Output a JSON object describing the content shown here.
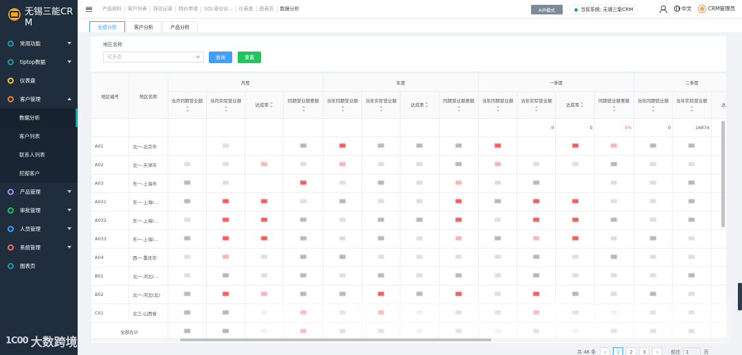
{
  "app": {
    "title": "无锡三能CRM"
  },
  "sidebar": {
    "items": [
      {
        "label": "常用功能",
        "color": "#1e9aa8",
        "caret": "down"
      },
      {
        "label": "tiptop数据",
        "color": "#1e9aa8",
        "caret": "down"
      },
      {
        "label": "仪表盘",
        "color": "#f5d020",
        "caret": ""
      },
      {
        "label": "客户管理",
        "color": "#f5863a",
        "caret": "up"
      }
    ],
    "sub_items": [
      {
        "label": "数据分析",
        "active": true
      },
      {
        "label": "客户列表",
        "active": false
      },
      {
        "label": "联系人列表",
        "active": false
      },
      {
        "label": "挖掘客户",
        "active": false
      }
    ],
    "items_after": [
      {
        "label": "产品管理",
        "color": "#a98ef5",
        "caret": "down"
      },
      {
        "label": "审批管理",
        "color": "#1fc55d",
        "caret": "down"
      },
      {
        "label": "人员管理",
        "color": "#409eff",
        "caret": "down"
      },
      {
        "label": "系统管理",
        "color": "#f56c6c",
        "caret": "down"
      },
      {
        "label": "图表页",
        "color": "#1e9aa8",
        "caret": ""
      }
    ],
    "watermark": "大数跨境",
    "watermark_logo": "1C00"
  },
  "topbar": {
    "nav": [
      "产品资料",
      "客户列表",
      "拜访记录",
      "特价申请",
      "SQL语句设...",
      "仪表盘",
      "图表页",
      "数据分析"
    ],
    "air_mode": "AIR模式",
    "current_system": "当前系统: 无锡三能CRM",
    "language": "中文",
    "user": "CRM管理员"
  },
  "tabs": [
    "业绩分析",
    "客户分析",
    "产品分析"
  ],
  "filter": {
    "label": "地区名称",
    "placeholder": "可多选",
    "query": "查询",
    "reset": "重置"
  },
  "table": {
    "col_code": "地区编号",
    "col_name": "地区名称",
    "groups": [
      "月度",
      "年度",
      "一季度",
      "二季度"
    ],
    "sub_cols": [
      "当月同期营业额",
      "当月实际营业额",
      "达成率",
      "同期营业额差额",
      "当年同期营业额",
      "当年实际营业额",
      "达成率",
      "同期营业额差额",
      "当年同期营业额",
      "当年实际营业额",
      "达成率",
      "同期营业额差额",
      "当年同期营业额",
      "当年实际营业额",
      "达成率"
    ],
    "first_row": [
      "",
      "",
      "",
      "",
      "",
      "",
      "",
      "",
      "",
      "0",
      "0",
      "0%",
      "0",
      "16874",
      ""
    ],
    "rows": [
      {
        "code": "A01",
        "name": "北一-北京市"
      },
      {
        "code": "A02",
        "name": "北一-天津市"
      },
      {
        "code": "A03",
        "name": "东一-上海市"
      },
      {
        "code": "A031",
        "name": "东一-上海(..."
      },
      {
        "code": "A032",
        "name": "东一-上海(..."
      },
      {
        "code": "A033",
        "name": "东一-上海(..."
      },
      {
        "code": "A04",
        "name": "西一-重庆市"
      },
      {
        "code": "B01",
        "name": "北一-河北(..."
      },
      {
        "code": "B02",
        "name": "北一-河北(北)"
      },
      {
        "code": "C01",
        "name": "北三-山西省"
      }
    ],
    "total_label": "全部合计"
  },
  "pagination": {
    "total": "共 46 条",
    "pages": [
      "1",
      "2",
      "3"
    ],
    "current": "1",
    "goto_label": "前往",
    "goto_value": "1",
    "page_suffix": "页"
  }
}
